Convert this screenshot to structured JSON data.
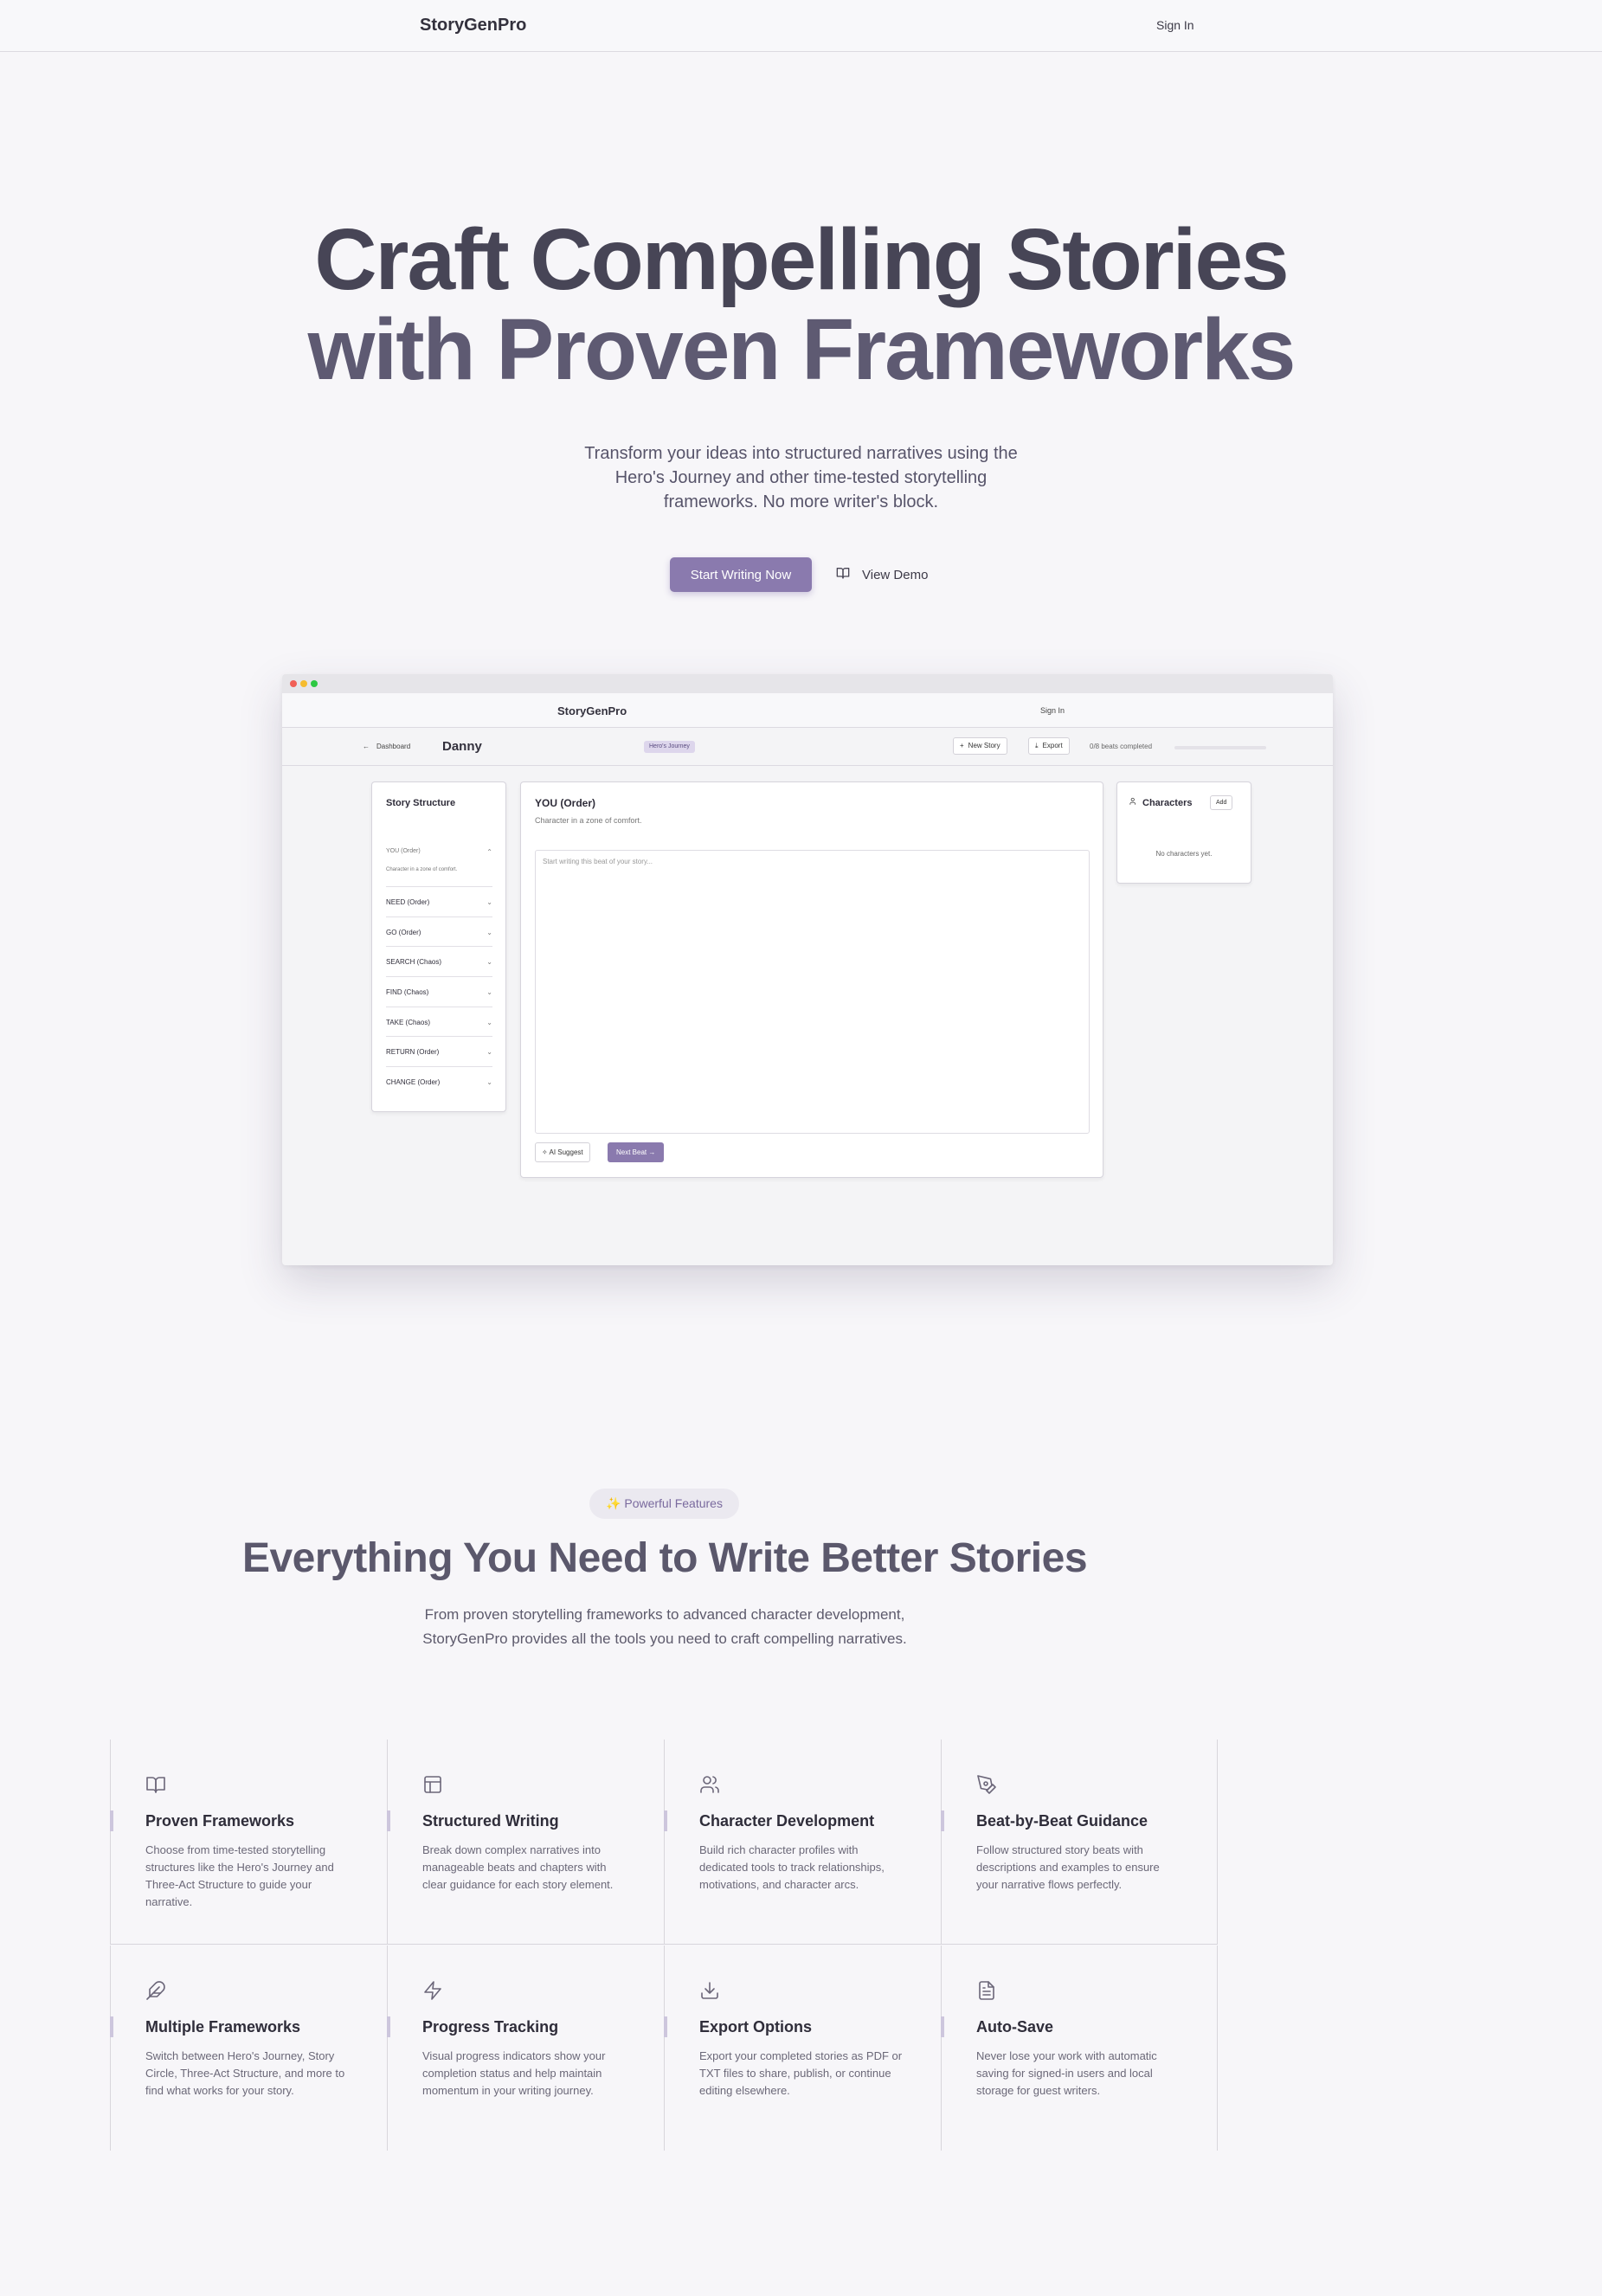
{
  "nav": {
    "brand": "StoryGenPro",
    "signin": "Sign In"
  },
  "hero": {
    "title_line1": "Craft Compelling Stories",
    "title_line2": "with Proven Frameworks",
    "subtitle": "Transform your ideas into structured narratives using the Hero's Journey and other time-tested storytelling frameworks. No more writer's block.",
    "primary_cta": "Start Writing Now",
    "secondary_cta": "View Demo"
  },
  "mockup": {
    "brand": "StoryGenPro",
    "signin": "Sign In",
    "back": "Dashboard",
    "story_title": "Danny",
    "framework_badge": "Hero's Journey",
    "new_story": "New Story",
    "export": "Export",
    "progress": "0/8 beats completed",
    "progress_fraction": 0,
    "structure_title": "Story Structure",
    "active_beat": "YOU (Order)",
    "active_beat_desc": "Character in a zone of comfort.",
    "beats": [
      "NEED (Order)",
      "GO (Order)",
      "SEARCH (Chaos)",
      "FIND (Chaos)",
      "TAKE (Chaos)",
      "RETURN (Order)",
      "CHANGE (Order)"
    ],
    "editor_title": "YOU (Order)",
    "editor_desc": "Character in a zone of comfort.",
    "editor_placeholder": "Start writing this beat of your story...",
    "ai_suggest": "AI Suggest",
    "next_beat": "Next Beat →",
    "characters_title": "Characters",
    "add": "Add",
    "no_characters": "No characters yet."
  },
  "features": {
    "pill": "✨ Powerful Features",
    "title": "Everything You Need to Write Better Stories",
    "subtitle": "From proven storytelling frameworks to advanced character development, StoryGenPro provides all the tools you need to craft compelling narratives.",
    "items": [
      {
        "icon": "book-icon",
        "title": "Proven Frameworks",
        "desc": "Choose from time-tested storytelling structures like the Hero's Journey and Three-Act Structure to guide your narrative."
      },
      {
        "icon": "layout-icon",
        "title": "Structured Writing",
        "desc": "Break down complex narratives into manageable beats and chapters with clear guidance for each story element."
      },
      {
        "icon": "users-icon",
        "title": "Character Development",
        "desc": "Build rich character profiles with dedicated tools to track relationships, motivations, and character arcs."
      },
      {
        "icon": "pen-tool-icon",
        "title": "Beat-by-Beat Guidance",
        "desc": "Follow structured story beats with descriptions and examples to ensure your narrative flows perfectly."
      },
      {
        "icon": "feather-icon",
        "title": "Multiple Frameworks",
        "desc": "Switch between Hero's Journey, Story Circle, Three-Act Structure, and more to find what works for your story."
      },
      {
        "icon": "zap-icon",
        "title": "Progress Tracking",
        "desc": "Visual progress indicators show your completion status and help maintain momentum in your writing journey."
      },
      {
        "icon": "download-icon",
        "title": "Export Options",
        "desc": "Export your completed stories as PDF or TXT files to share, publish, or continue editing elsewhere."
      },
      {
        "icon": "file-text-icon",
        "title": "Auto-Save",
        "desc": "Never lose your work with automatic saving for signed-in users and local storage for guest writers."
      }
    ]
  },
  "colors": {
    "accent": "#8a7aae",
    "background": "#f7f6f9",
    "heading": "#474556"
  }
}
